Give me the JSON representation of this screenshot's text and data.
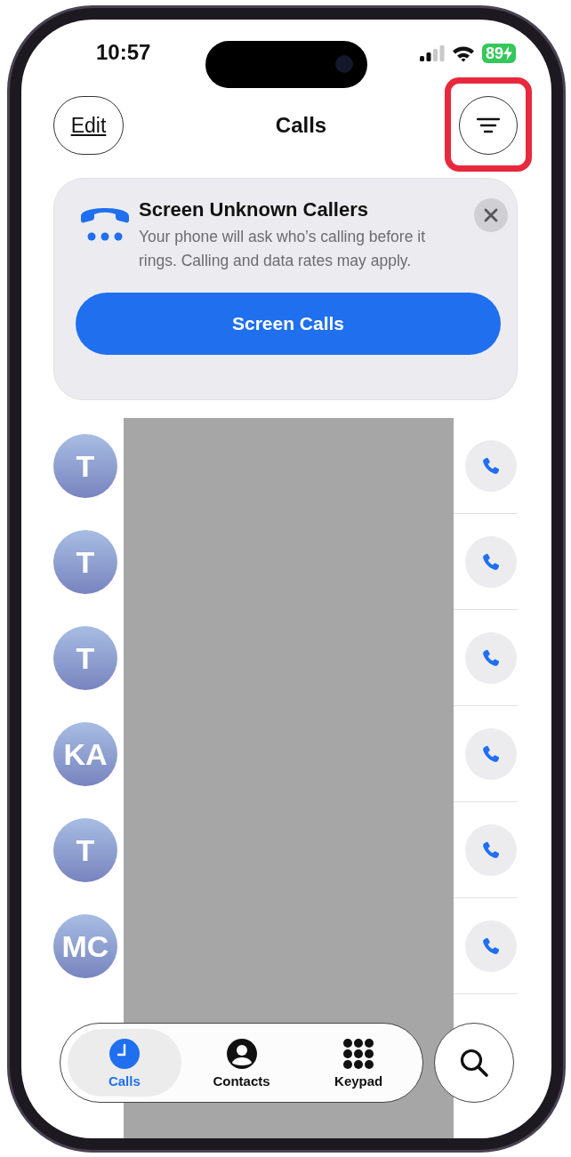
{
  "status_bar": {
    "time": "10:57",
    "battery": "89",
    "charging": true
  },
  "nav": {
    "edit": "Edit",
    "title": "Calls",
    "filter_highlighted": true
  },
  "banner": {
    "title": "Screen Unknown Callers",
    "body": "Your phone will ask who’s calling before it rings. Calling and data rates may apply.",
    "button": "Screen Calls"
  },
  "calls": [
    {
      "initials": "T"
    },
    {
      "initials": "T"
    },
    {
      "initials": "T"
    },
    {
      "initials": "KA"
    },
    {
      "initials": "T"
    },
    {
      "initials": "MC"
    }
  ],
  "tabs": [
    {
      "label": "Calls",
      "selected": true,
      "kind": "clock"
    },
    {
      "label": "Contacts",
      "selected": false,
      "kind": "person"
    },
    {
      "label": "Keypad",
      "selected": false,
      "kind": "keypad"
    }
  ]
}
